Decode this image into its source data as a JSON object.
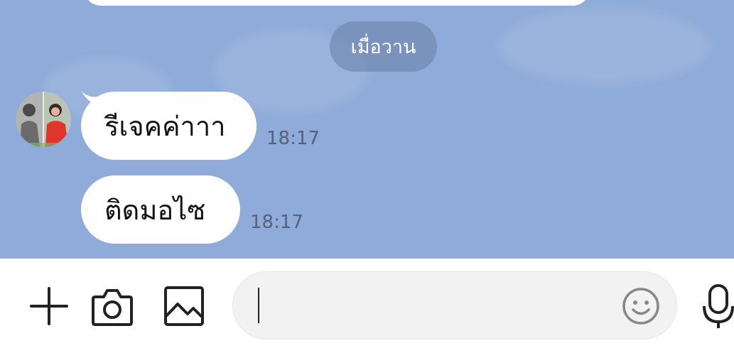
{
  "chat": {
    "date_separator": "เมื่อวาน",
    "messages": [
      {
        "text": "รีเจคค่าาา",
        "time": "18:17"
      },
      {
        "text": "ติดมอไซ",
        "time": "18:17"
      }
    ]
  },
  "input_bar": {
    "add_icon": "plus-icon",
    "camera_icon": "camera-icon",
    "image_icon": "image-icon",
    "emoji_icon": "smiley-icon",
    "mic_icon": "microphone-icon",
    "message_value": ""
  },
  "colors": {
    "chat_background": "#8eabd9",
    "bubble": "#ffffff",
    "date_chip": "#6e84aa",
    "timestamp": "#56627a",
    "icon": "#222222"
  }
}
